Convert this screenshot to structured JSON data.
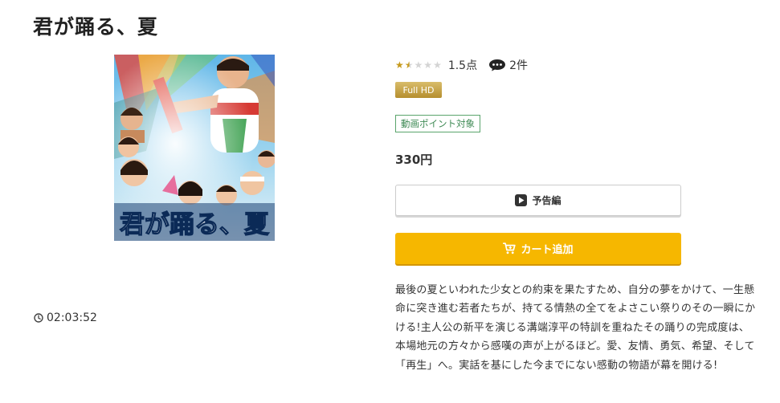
{
  "page": {
    "title": "君が踊る、夏"
  },
  "poster": {
    "title_text": "君が踊る、夏",
    "alt": "君が踊る、夏"
  },
  "duration": "02:03:52",
  "rating": {
    "stars": 1.5,
    "max_stars": 5,
    "score_text": "1.5点",
    "review_count_text": "2件"
  },
  "badges": {
    "quality": "Full HD",
    "points": "動画ポイント対象"
  },
  "price": "330円",
  "buttons": {
    "trailer_label": "予告編",
    "cart_label": "カート追加"
  },
  "description": "最後の夏といわれた少女との約束を果たすため、自分の夢をかけて、一生懸命に突き進む若者たちが、持てる情熱の全てをよさこい祭りのその一瞬にかける!主人公の新平を演じる溝端淳平の特訓を重ねたその踊りの完成度は、本場地元の方々から感嘆の声が上がるほど。愛、友情、勇気、希望、そして「再生」へ。実話を基にした今までにない感動の物語が幕を開ける!",
  "colors": {
    "accent_yellow": "#f6b700",
    "star_gold": "#c69a1d",
    "points_green": "#3f8a55",
    "fullhd_gold": "#c9a54a"
  }
}
